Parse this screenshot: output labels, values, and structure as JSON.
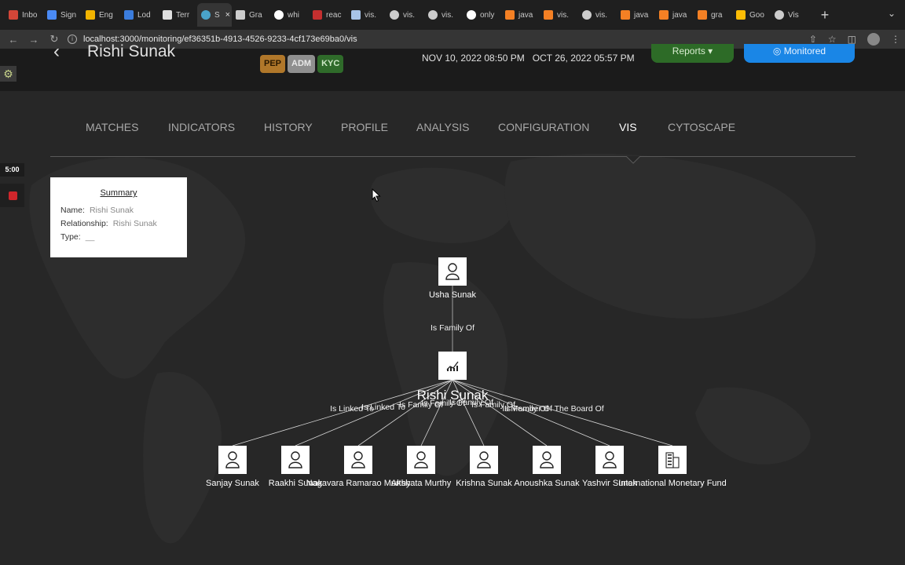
{
  "browser": {
    "tabs": [
      {
        "label": "Inbo",
        "color": "#d44638",
        "icon": "gmail-icon"
      },
      {
        "label": "Sign",
        "color": "#4a8af4",
        "icon": "docs-icon"
      },
      {
        "label": "Eng",
        "color": "#f2b400",
        "icon": "drive-icon"
      },
      {
        "label": "Lod",
        "color": "#3b7ddd",
        "icon": "underline-icon"
      },
      {
        "label": "Terr",
        "color": "#e0e0e0",
        "icon": "github-icon"
      },
      {
        "label": "S",
        "color": "#4aa3c9",
        "icon": "spinner-icon",
        "active": true
      },
      {
        "label": "Gra",
        "color": "#cccccc",
        "icon": "graph-icon"
      },
      {
        "label": "whi",
        "color": "#ffffff",
        "icon": "google-icon"
      },
      {
        "label": "reac",
        "color": "#c42f2f",
        "icon": "npm-icon"
      },
      {
        "label": "vis.",
        "color": "#a8c4e8",
        "icon": "vis-icon"
      },
      {
        "label": "vis.",
        "color": "#cccccc",
        "icon": "globe-icon"
      },
      {
        "label": "vis.",
        "color": "#cccccc",
        "icon": "globe-icon"
      },
      {
        "label": "only",
        "color": "#ffffff",
        "icon": "google-icon"
      },
      {
        "label": "java",
        "color": "#f48024",
        "icon": "stackoverflow-icon"
      },
      {
        "label": "vis.",
        "color": "#f48024",
        "icon": "stackoverflow-icon"
      },
      {
        "label": "vis.",
        "color": "#cccccc",
        "icon": "globe-icon"
      },
      {
        "label": "java",
        "color": "#f48024",
        "icon": "stackoverflow-icon"
      },
      {
        "label": "java",
        "color": "#f48024",
        "icon": "stackoverflow-icon"
      },
      {
        "label": "gra",
        "color": "#f48024",
        "icon": "stackoverflow-icon"
      },
      {
        "label": "Goo",
        "color": "#fbbc05",
        "icon": "google-cloud-icon"
      },
      {
        "label": "Vis",
        "color": "#cccccc",
        "icon": "globe-icon"
      }
    ],
    "url": "localhost:3000/monitoring/ef36351b-4913-4526-9233-4cf173e69ba0/vis"
  },
  "header": {
    "name": "Rishi Sunak",
    "badges": {
      "pep": "PEP",
      "adm": "ADM",
      "kyc": "KYC"
    },
    "date1": "NOV 10, 2022 08:50 PM",
    "date2": "OCT 26, 2022 05:57 PM",
    "reports_label": "Reports",
    "monitored_label": "Monitored"
  },
  "nav": {
    "matches": "MATCHES",
    "indicators": "INDICATORS",
    "history": "HISTORY",
    "profile": "PROFILE",
    "analysis": "ANALYSIS",
    "configuration": "CONFIGURATION",
    "vis": "VIS",
    "cytoscape": "CYTOSCAPE",
    "active": "VIS"
  },
  "recorder": {
    "timer": "5:00"
  },
  "summary": {
    "title": "Summary",
    "name_label": "Name:",
    "name_value": "Rishi Sunak",
    "relationship_label": "Relationship:",
    "relationship_value": "Rishi Sunak",
    "type_label": "Type:",
    "type_value": "__"
  },
  "graph": {
    "center": {
      "label": "Rishi Sunak",
      "icon": "chart-icon"
    },
    "top": {
      "label": "Usha Sunak",
      "edge": "Is Family Of",
      "icon": "person-icon"
    },
    "children": [
      {
        "label": "Sanjay Sunak",
        "edge": "Is Linked To",
        "icon": "person-icon"
      },
      {
        "label": "Raakhi Sunak",
        "edge": "Is Linked To",
        "icon": "person-icon"
      },
      {
        "label": "Nagavara Ramarao Murthy",
        "edge": "Is Family Of",
        "icon": "person-icon"
      },
      {
        "label": "Akshata Murthy",
        "edge": "Is Family Of",
        "icon": "person-icon"
      },
      {
        "label": "Krishna Sunak",
        "edge": "Is Family Of",
        "icon": "person-icon"
      },
      {
        "label": "Anoushka Sunak",
        "edge": "Is Family Of",
        "icon": "person-icon"
      },
      {
        "label": "Yashvir Sunak",
        "edge": "Is Family Of",
        "icon": "person-icon"
      },
      {
        "label": "International Monetary Fund",
        "edge": "Is Member Of The Board Of",
        "icon": "building-icon"
      }
    ]
  }
}
